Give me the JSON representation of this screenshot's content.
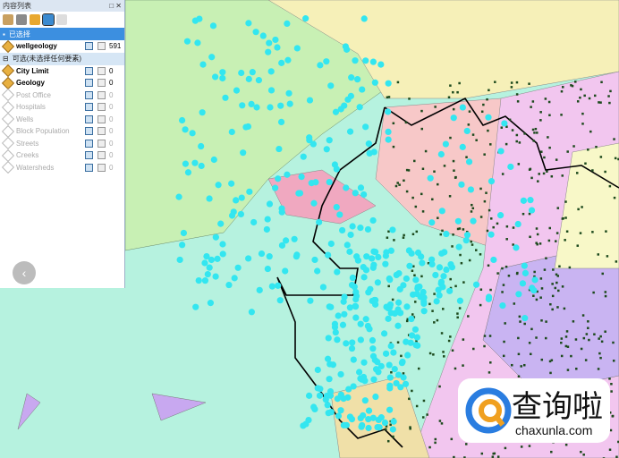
{
  "toc": {
    "title": "内容列表",
    "tools": [
      "list-by-drawing-order-icon",
      "list-by-source-icon",
      "list-by-visibility-icon",
      "list-by-selection-icon",
      "options-icon"
    ],
    "selected_group": "已选择",
    "selected_layers": [
      {
        "name": "wellgeology",
        "count": "591"
      }
    ],
    "available_group": "可选(未选择任何要素)",
    "layers": [
      {
        "name": "City Limit",
        "count": "0",
        "active": true
      },
      {
        "name": "Geology",
        "count": "0",
        "active": true
      },
      {
        "name": "Post Office",
        "count": "0",
        "active": false
      },
      {
        "name": "Hospitals",
        "count": "0",
        "active": false
      },
      {
        "name": "Wells",
        "count": "0",
        "active": false
      },
      {
        "name": "Block Population",
        "count": "0",
        "active": false
      },
      {
        "name": "Streets",
        "count": "0",
        "active": false
      },
      {
        "name": "Creeks",
        "count": "0",
        "active": false
      },
      {
        "name": "Watersheds",
        "count": "0",
        "active": false
      }
    ]
  },
  "watermark": {
    "cn": "查询啦",
    "en": "chaxunla.com"
  },
  "colors": {
    "selected_points": "#33e6f0",
    "wells": "#1d4a1d",
    "boundary": "#000000"
  }
}
